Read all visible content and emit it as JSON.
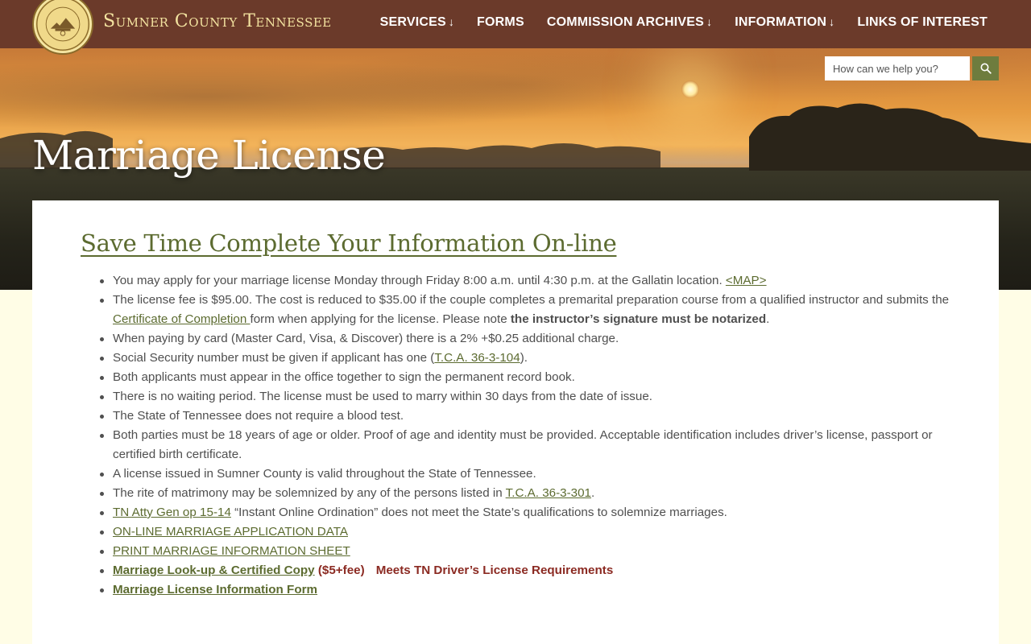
{
  "header": {
    "seal_text": "SUMNER COUNTY TENNESSEE 1786",
    "site_title": "Sumner County Tennessee",
    "nav": [
      {
        "label": "SERVICES",
        "dropdown": true
      },
      {
        "label": "FORMS",
        "dropdown": false
      },
      {
        "label": "COMMISSION ARCHIVES",
        "dropdown": true
      },
      {
        "label": "INFORMATION",
        "dropdown": true
      },
      {
        "label": "LINKS OF INTEREST",
        "dropdown": false
      }
    ],
    "dropdown_arrow": "↓"
  },
  "search": {
    "placeholder": "How can we help you?",
    "icon": "search-icon"
  },
  "hero": {
    "title": "Marriage License"
  },
  "content": {
    "heading": "Save Time Complete Your Information On-line",
    "items": {
      "i1": {
        "text": "You may apply for your marriage license Monday through Friday 8:00 a.m. until 4:30 p.m. at the Gallatin location. ",
        "link": "<MAP>"
      },
      "i2": {
        "t1": "The license fee is $95.00. The cost is reduced to $35.00 if the couple completes a premarital preparation course from a qualified instructor and submits the",
        "link": " Certificate of Completion ",
        "t2": "form when applying for the license. Please note ",
        "bold": "the instructor’s signature must be notarized",
        "t3": "."
      },
      "i3": {
        "text": "When paying by card (Master Card, Visa, & Discover) there is a 2% +$0.25 additional charge."
      },
      "i4": {
        "t1": "Social Security number must be given if applicant has one (",
        "link": "T.C.A. 36-3-104",
        "t2": ")."
      },
      "i5": {
        "text": "Both applicants must appear in the office together to sign the permanent record book."
      },
      "i6": {
        "text": "There is no waiting period. The license must be used to marry within 30 days from the date of issue."
      },
      "i7": {
        "text": "The State of Tennessee does not require a blood test."
      },
      "i8": {
        "text": "Both parties must be 18 years of age or older. Proof of age and identity must be provided. Acceptable identification includes driver’s license, passport or certified birth certificate."
      },
      "i9": {
        "text": "A license issued in Sumner County is valid throughout the State of Tennessee."
      },
      "i10": {
        "t1": "The rite of matrimony may be solemnized by any of the persons listed in ",
        "link": "T.C.A. 36-3-301",
        "t2": "."
      },
      "i11": {
        "link": "TN Atty Gen op 15-14",
        "text": " “Instant Online Ordination” does not meet the State’s qualifications to solemnize marriages."
      },
      "i12": {
        "link": "ON-LINE MARRIAGE APPLICATION DATA"
      },
      "i13": {
        "link": "PRINT MARRIAGE INFORMATION SHEET"
      },
      "i14": {
        "link": "Marriage Look-up & Certified Copy",
        "fee": " ($5+fee)",
        "note": "Meets TN Driver’s License Requirements"
      },
      "i15": {
        "link": "Marriage License Information Form"
      }
    }
  },
  "colors": {
    "topbar": "#6b3a2a",
    "title_gold": "#f3e3a0",
    "link_green": "#5c6b30",
    "search_btn": "#6e7c3e",
    "alert_red": "#8b2a22",
    "page_bg": "#fffde6"
  }
}
